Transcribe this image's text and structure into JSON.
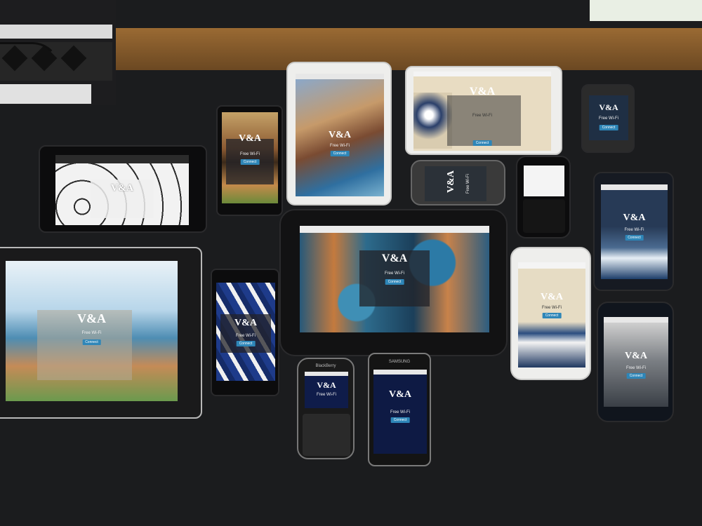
{
  "scene": {
    "colors": {
      "desk": "#1b1c1e",
      "floor": "#8b5e2d",
      "va_blue": "#2e86b8",
      "screen_dark": "#26303a"
    }
  },
  "devices": {
    "ipad_mini": {
      "brand": "V&A",
      "title": "Free Wi-Fi",
      "button": "Connect"
    },
    "galaxy_note_tablet": {
      "brand": "V&A",
      "title": "Free Wi-Fi",
      "button": "Connect"
    },
    "xperia_phone": {
      "brand": "V&A",
      "title": "Free Wi-Fi",
      "button": "Connect"
    },
    "kindle_fire": {
      "brand": "V&A"
    },
    "htc_phone": {
      "brand": "V&A",
      "title": "Free Wi-Fi"
    },
    "phone_top_right": {
      "brand": "V&A",
      "title": "Free Wi-Fi",
      "button": "Connect"
    },
    "blackberry_bold": {
      "brand": ""
    },
    "galaxy_s4_mid_right": {
      "brand": "V&A",
      "title": "Free Wi-Fi",
      "button": "Connect"
    },
    "nexus_10": {
      "brand": "V&A",
      "title": "Free Wi-Fi",
      "button": "Connect"
    },
    "iphone_6": {
      "brand": "V&A",
      "title": "Free Wi-Fi",
      "button": "Connect"
    },
    "galaxy_s3_bottom_right": {
      "brand": "V&A",
      "title": "Free Wi-Fi",
      "button": "Connect"
    },
    "ipad_large": {
      "brand": "V&A",
      "title": "Free Wi-Fi",
      "button": "Connect"
    },
    "xperia_mid": {
      "brand": "V&A",
      "title": "Free Wi-Fi",
      "button": "Connect"
    },
    "blackberry_curve": {
      "brand": "V&A",
      "title": "Free Wi-Fi",
      "header": "BlackBerry"
    },
    "samsung_phone": {
      "brand": "V&A",
      "title": "Free Wi-Fi",
      "button": "Connect",
      "header": "SAMSUNG"
    }
  }
}
